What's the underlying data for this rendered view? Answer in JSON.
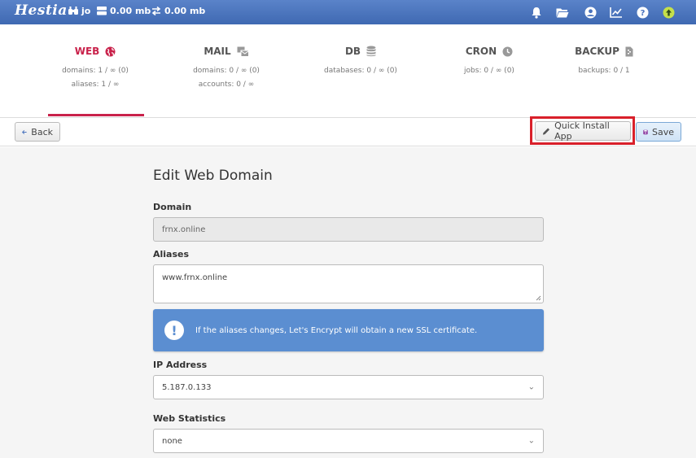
{
  "topbar": {
    "logo": "Hestia",
    "user": "jo",
    "disk": "0.00 mb",
    "bandwidth": "0.00 mb",
    "icons": [
      "bell-icon",
      "folder-icon",
      "user-icon",
      "chart-icon",
      "help-icon",
      "update-icon"
    ]
  },
  "tabs": [
    {
      "label": "WEB",
      "icon": "globe-icon",
      "lines": [
        "domains: 1 / ∞ (0)",
        "aliases: 1 / ∞"
      ],
      "active": true
    },
    {
      "label": "MAIL",
      "icon": "mail-icon",
      "lines": [
        "domains: 0 / ∞ (0)",
        "accounts: 0 / ∞"
      ],
      "active": false
    },
    {
      "label": "DB",
      "icon": "database-icon",
      "lines": [
        "databases: 0 / ∞ (0)"
      ],
      "active": false
    },
    {
      "label": "CRON",
      "icon": "clock-icon",
      "lines": [
        "jobs: 0 / ∞ (0)"
      ],
      "active": false
    },
    {
      "label": "BACKUP",
      "icon": "file-icon",
      "lines": [
        "backups: 0 / 1"
      ],
      "active": false
    }
  ],
  "toolbar": {
    "back_label": "Back",
    "quick_install_label": "Quick Install App",
    "save_label": "Save"
  },
  "form": {
    "title": "Edit Web Domain",
    "domain_label": "Domain",
    "domain_value": "frnx.online",
    "aliases_label": "Aliases",
    "aliases_value": "www.frnx.online",
    "alert_text": "If the aliases changes, Let's Encrypt will obtain a new SSL certificate.",
    "ip_label": "IP Address",
    "ip_value": "5.187.0.133",
    "stats_label": "Web Statistics",
    "stats_value": "none"
  },
  "colors": {
    "topbar": "#4a73bd",
    "accent_active": "#c9224b",
    "alert": "#5b8ed1",
    "highlight": "#d9202a"
  }
}
